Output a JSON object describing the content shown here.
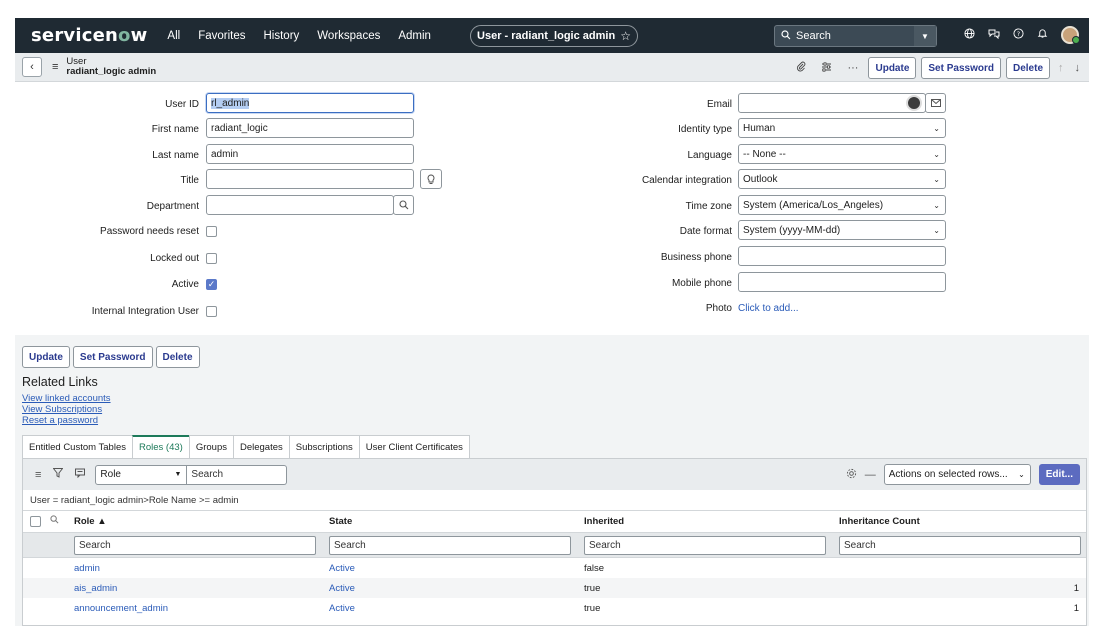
{
  "nav": {
    "logo_prefix": "servicen",
    "logo_o": "o",
    "logo_suffix": "w",
    "links": [
      "All",
      "Favorites",
      "History",
      "Workspaces",
      "Admin"
    ],
    "record_title": "User - radiant_logic admin",
    "search_placeholder": "Search",
    "icons": [
      "globe-icon",
      "chat-icon",
      "help-icon",
      "bell-icon",
      "avatar"
    ]
  },
  "header": {
    "type": "User",
    "name": "radiant_logic admin",
    "buttons": {
      "update": "Update",
      "set_password": "Set Password",
      "delete": "Delete"
    }
  },
  "form": {
    "left": {
      "user_id": {
        "label": "User ID",
        "value": "rl_admin"
      },
      "first_name": {
        "label": "First name",
        "value": "radiant_logic"
      },
      "last_name": {
        "label": "Last name",
        "value": "admin"
      },
      "title": {
        "label": "Title",
        "value": ""
      },
      "department": {
        "label": "Department",
        "value": ""
      },
      "password_reset": {
        "label": "Password needs reset",
        "checked": false
      },
      "locked_out": {
        "label": "Locked out",
        "checked": false
      },
      "active": {
        "label": "Active",
        "checked": true
      },
      "internal_integration": {
        "label": "Internal Integration User",
        "checked": false
      }
    },
    "right": {
      "email": {
        "label": "Email",
        "value": ""
      },
      "identity_type": {
        "label": "Identity type",
        "value": "Human"
      },
      "language": {
        "label": "Language",
        "value": "-- None --"
      },
      "calendar": {
        "label": "Calendar integration",
        "value": "Outlook"
      },
      "time_zone": {
        "label": "Time zone",
        "value": "System (America/Los_Angeles)"
      },
      "date_format": {
        "label": "Date format",
        "value": "System (yyyy-MM-dd)"
      },
      "business_phone": {
        "label": "Business phone",
        "value": ""
      },
      "mobile_phone": {
        "label": "Mobile phone",
        "value": ""
      },
      "photo": {
        "label": "Photo",
        "value": "Click to add..."
      }
    }
  },
  "bottom_buttons": {
    "update": "Update",
    "set_password": "Set Password",
    "delete": "Delete"
  },
  "related": {
    "title": "Related Links",
    "links": [
      "View linked accounts",
      "View Subscriptions",
      "Reset a password"
    ]
  },
  "tabs": [
    {
      "label": "Entitled Custom Tables",
      "active": false
    },
    {
      "label": "Roles (43)",
      "active": true
    },
    {
      "label": "Groups",
      "active": false
    },
    {
      "label": "Delegates",
      "active": false
    },
    {
      "label": "Subscriptions",
      "active": false
    },
    {
      "label": "User Client Certificates",
      "active": false
    }
  ],
  "list": {
    "search_field": "Role",
    "search_placeholder": "Search",
    "actions_label": "Actions on selected rows...",
    "edit_label": "Edit...",
    "breadcrumb": "User = radiant_logic admin>Role Name >= admin",
    "columns": [
      "Role ▲",
      "State",
      "Inherited",
      "Inheritance Count"
    ],
    "filter_placeholder": "Search",
    "rows": [
      {
        "role": "admin",
        "state": "Active",
        "inherited": "false",
        "count": ""
      },
      {
        "role": "ais_admin",
        "state": "Active",
        "inherited": "true",
        "count": "1"
      },
      {
        "role": "announcement_admin",
        "state": "Active",
        "inherited": "true",
        "count": "1"
      }
    ]
  }
}
